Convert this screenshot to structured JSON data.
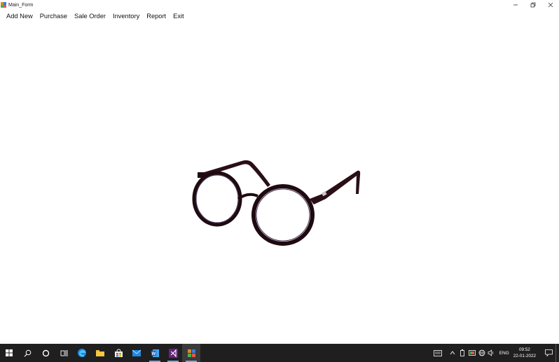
{
  "window": {
    "title": "Main_Form"
  },
  "menu": {
    "items": [
      {
        "label": "Add New"
      },
      {
        "label": "Purchase"
      },
      {
        "label": "Sale Order"
      },
      {
        "label": "Inventory"
      },
      {
        "label": "Report"
      },
      {
        "label": "Exit"
      }
    ]
  },
  "content": {
    "image": "eyeglasses-photo"
  },
  "taskbar": {
    "apps": [
      "start",
      "search",
      "cortana",
      "task-view",
      "edge",
      "file-explorer",
      "store",
      "mail",
      "word",
      "visual-studio",
      "main-form-app"
    ],
    "tray": {
      "language": "ENG",
      "time": "09:52",
      "date": "22-01-2022"
    }
  },
  "colors": {
    "taskbar_bg": "#1f1f1f",
    "frame_color": "#2a0f16",
    "accent": "#7aa7e6"
  }
}
